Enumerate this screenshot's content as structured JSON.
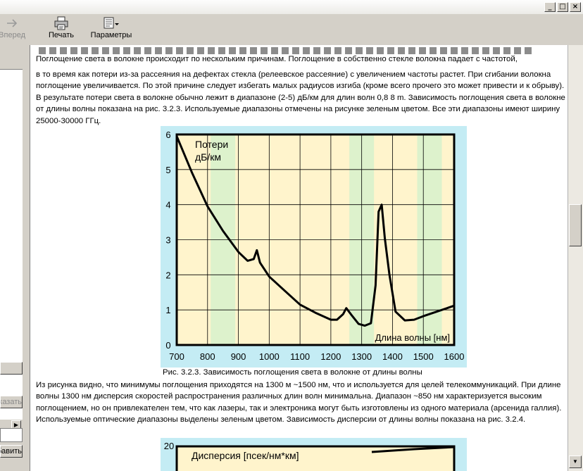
{
  "window": {
    "buttons": [
      "_",
      "□",
      "×"
    ]
  },
  "toolbar": {
    "forward_label": "Вперед",
    "print_label": "Печать",
    "options_label": "Параметры"
  },
  "left_pane": {
    "button1_label": "Показать",
    "button2_label": "Добавить"
  },
  "text": {
    "para1_line1": "Поглощение света в волокне происходит по нескольким причинам. Поглощение в собственно стекле волокна падает с частотой,",
    "para1_rest": "в то время как потери из-за рассеяния на дефектах стекла (релеевское рассеяние) с увеличением частоты растет. При сгибании волокна поглощение увеличивается. По этой причине следует избегать малых радиусов изгиба (кроме всего прочего это может привести и к обрыву). В результате потери света в волокне обычно лежит в диапазоне (2-5) дБ/км для длин волн 0,8 8 m. Зависимость поглощения света в волокне от длины волны показана на рис. 3.2.3. Используемые диапазоны отмечены на рисунке зеленым цветом. Все эти диапазоны имеют ширину 25000-30000 ГГц.",
    "caption": "Рис. 3.2.3. Зависимость поглощения света в волокне от длины волны",
    "para2": "Из рисунка видно, что минимумы поглощения приходятся на 1300 м ~1500 нм, что и используется для целей телекоммуникаций. При длине волны 1300 нм дисперсия скоростей распространения различных длин волн минимальна. Диапазон ~850 нм характеризуется высоким поглощением, но он привлекателен тем, что как лазеры, так и электроника могут быть изготовлены из одного материала (арсенида галлия). Используемые оптические диапазоны выделены зеленым цветом. Зависимость дисперсии от длины волны показана на рис. 3.2.4."
  },
  "chart_data": [
    {
      "type": "line",
      "ylabel": "Потери дБ/км",
      "ylabel_lines": [
        "Потери",
        "дБ/км"
      ],
      "xlabel": "Длина волны [нм]",
      "xlim": [
        700,
        1600
      ],
      "ylim": [
        0,
        6
      ],
      "xticks": [
        700,
        800,
        900,
        1000,
        1100,
        1200,
        1300,
        1400,
        1500,
        1600
      ],
      "yticks": [
        0,
        1,
        2,
        3,
        4,
        5,
        6
      ],
      "grid": true,
      "colors": {
        "background": "#fff4cc",
        "band": "#ddf2cc",
        "frame": "#c4ecf4",
        "line": "#000000"
      },
      "bands": [
        [
          810,
          890
        ],
        [
          1260,
          1340
        ],
        [
          1480,
          1560
        ]
      ],
      "x": [
        700,
        750,
        800,
        850,
        900,
        930,
        950,
        960,
        970,
        1000,
        1050,
        1100,
        1150,
        1200,
        1220,
        1240,
        1250,
        1270,
        1290,
        1310,
        1330,
        1345,
        1355,
        1365,
        1375,
        1390,
        1410,
        1440,
        1470,
        1500,
        1550,
        1600
      ],
      "y": [
        5.95,
        4.9,
        3.95,
        3.25,
        2.65,
        2.4,
        2.45,
        2.7,
        2.35,
        1.95,
        1.55,
        1.15,
        0.92,
        0.72,
        0.72,
        0.88,
        1.05,
        0.82,
        0.6,
        0.55,
        0.62,
        1.7,
        3.8,
        4.0,
        3.05,
        2.0,
        0.95,
        0.7,
        0.72,
        0.82,
        0.97,
        1.12
      ]
    },
    {
      "type": "line",
      "ylabel": "Дисперсия [псек/нм*км]",
      "ylim_top_tick": 20
    }
  ]
}
